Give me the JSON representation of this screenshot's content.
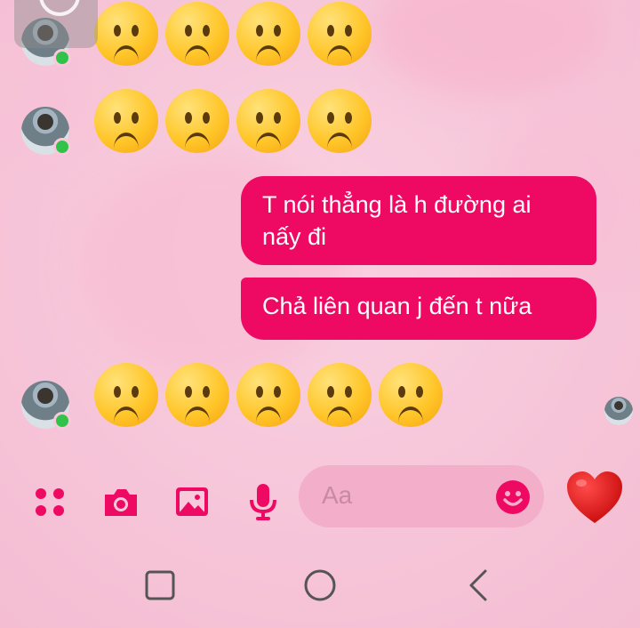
{
  "background": {
    "accent": "#ee0a63",
    "base": "#f7c9db"
  },
  "conversation": {
    "rows": [
      {
        "type": "emoji",
        "sender": "other",
        "emoji": "🙁",
        "count": 4
      },
      {
        "type": "emoji",
        "sender": "other",
        "emoji": "🙁",
        "count": 4
      },
      {
        "type": "text",
        "sender": "me",
        "text": "T nói thẳng là h đường ai nấy đi"
      },
      {
        "type": "text",
        "sender": "me",
        "text": "Chả liên quan j đến t nữa"
      },
      {
        "type": "emoji",
        "sender": "other",
        "emoji": "🙁",
        "count": 5
      }
    ]
  },
  "composer": {
    "placeholder": "Aa",
    "icons": [
      "apps-icon",
      "camera-icon",
      "image-icon",
      "microphone-icon",
      "emoji-icon",
      "heart-icon"
    ]
  },
  "navbar": {
    "icons": [
      "recent-apps-icon",
      "home-icon",
      "back-icon"
    ]
  }
}
